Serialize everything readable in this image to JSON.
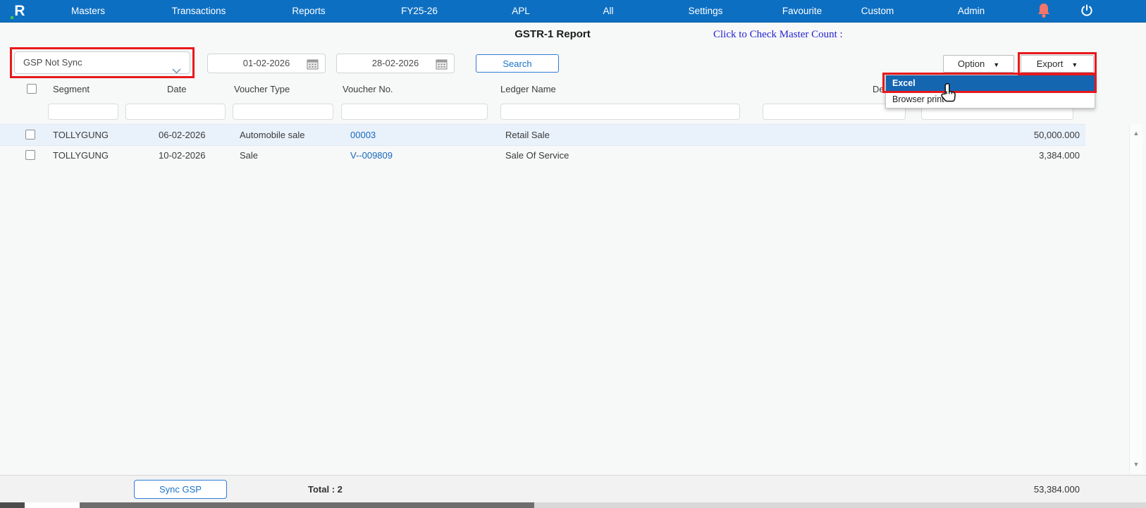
{
  "nav": {
    "logo_letter": "R",
    "items": [
      "Masters",
      "Transactions",
      "Reports",
      "FY25-26",
      "APL",
      "All",
      "Settings",
      "Favourite",
      "Custom",
      "Admin"
    ]
  },
  "header": {
    "title": "GSTR-1 Report",
    "master_count_link": "Click to Check Master Count :"
  },
  "filters": {
    "status_dropdown_value": "GSP Not Sync",
    "date_from": "01-02-2026",
    "date_to": "28-02-2026",
    "search_label": "Search",
    "option_label": "Option",
    "export_label": "Export"
  },
  "export_menu": {
    "items": [
      {
        "label": "Excel",
        "selected": true
      },
      {
        "label": "Browser print",
        "selected": false
      }
    ]
  },
  "table": {
    "columns": [
      "Segment",
      "Date",
      "Voucher Type",
      "Voucher No.",
      "Ledger Name",
      "De"
    ],
    "rows": [
      {
        "segment": "TOLLYGUNG",
        "date": "06-02-2026",
        "voucher_type": "Automobile sale",
        "voucher_no": "00003",
        "ledger_name": "Retail Sale",
        "amount": "50,000.000"
      },
      {
        "segment": "TOLLYGUNG",
        "date": "10-02-2026",
        "voucher_type": "Sale",
        "voucher_no": "V--009809",
        "ledger_name": "Sale Of Service",
        "amount": "3,384.000"
      }
    ]
  },
  "footer": {
    "sync_button": "Sync GSP",
    "total_label": "Total : 2",
    "total_amount": "53,384.000"
  },
  "colors": {
    "nav_blue": "#0d6fc2",
    "selected_item_blue": "#1566b0",
    "annotation_red": "#e8191c",
    "link_blue": "#1669bd",
    "row_highlight": "#e9f1fb",
    "bell_coral": "#f4756b"
  }
}
